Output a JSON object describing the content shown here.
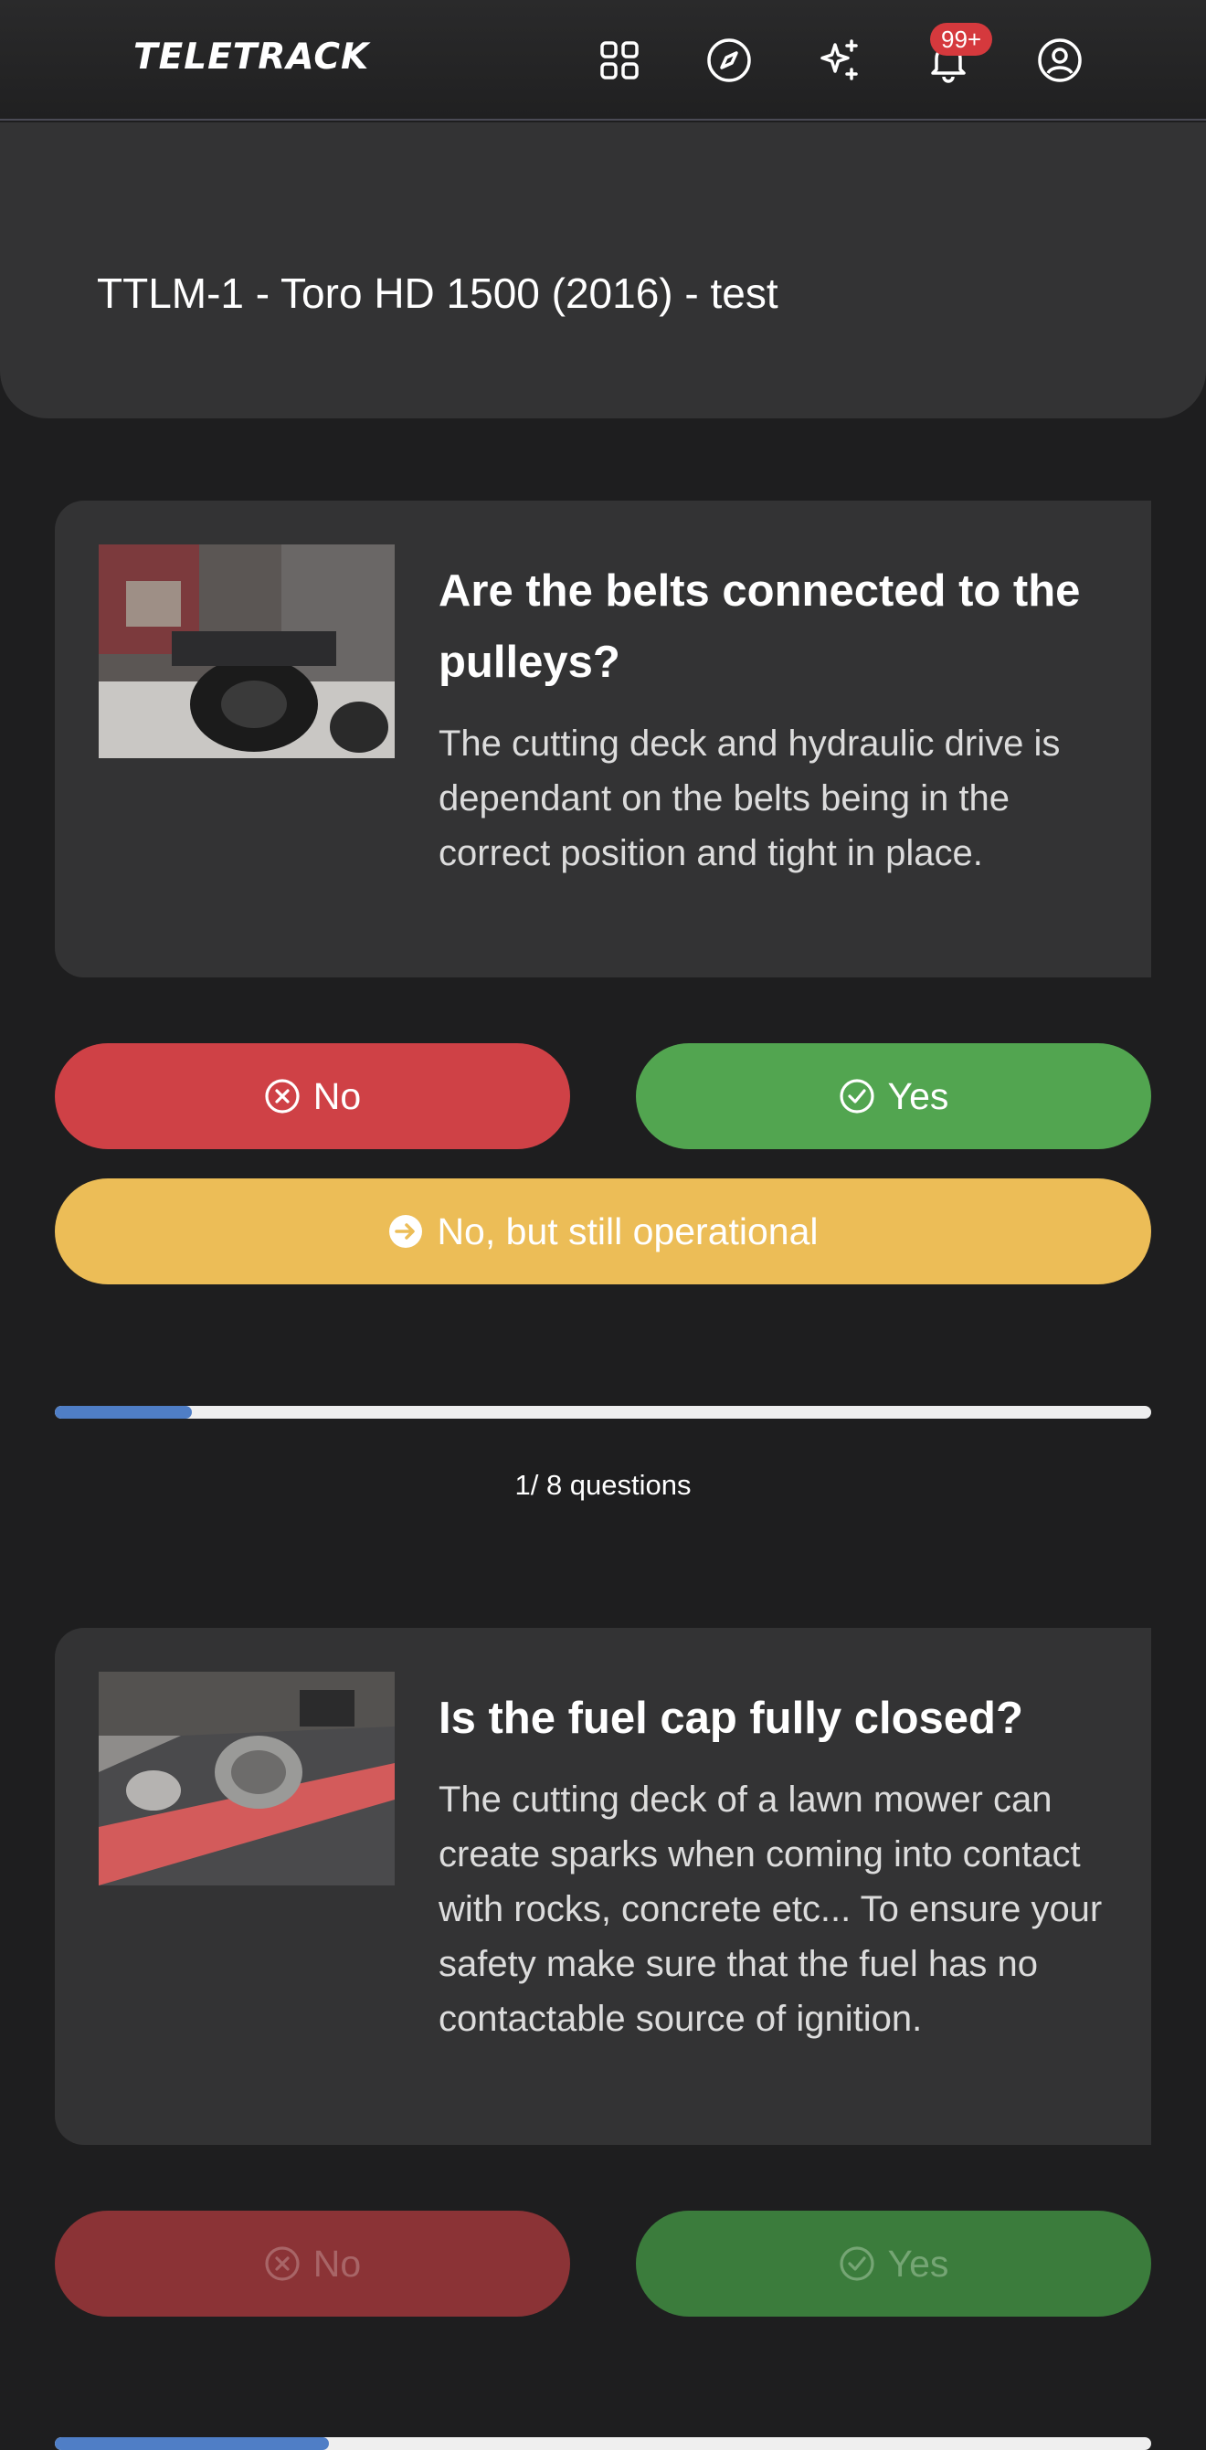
{
  "header": {
    "logo": "TELETRACK",
    "notification_badge": "99+",
    "icons": [
      "apps-grid-icon",
      "compass-icon",
      "sparkles-icon",
      "bell-icon",
      "account-icon"
    ]
  },
  "vehicle": {
    "title": "TTLM-1 - Toro HD 1500 (2016) - test"
  },
  "questions": [
    {
      "title": "Are the belts connected to the pulleys?",
      "description": "The cutting deck and hydraulic drive is dependant on the belts being in the correct position and tight in place.",
      "no_label": "No",
      "yes_label": "Yes",
      "partial_label": "No, but still operational",
      "progress_fraction": 0.125,
      "progress_text": "1/ 8 questions"
    },
    {
      "title": "Is the fuel cap fully closed?",
      "description": "The cutting deck of a lawn mower can create sparks when coming into contact with rocks, concrete etc... To ensure your safety make sure that the fuel has no contactable source of ignition.",
      "no_label": "No",
      "yes_label": "Yes",
      "progress_fraction": 0.25
    }
  ],
  "colors": {
    "no": "#cf4146",
    "yes": "#52a550",
    "partial": "#ecbd57",
    "progress": "#4f7ec6",
    "badge": "#d5393d"
  }
}
